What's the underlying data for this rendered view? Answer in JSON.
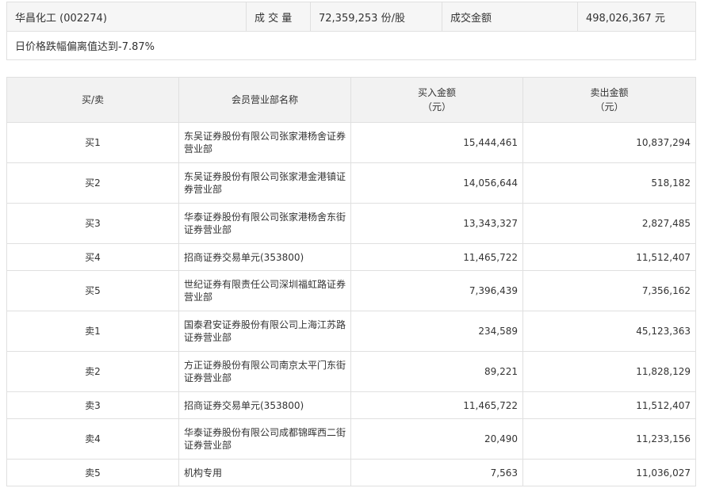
{
  "summary": {
    "stock_name": "华昌化工 (002274)",
    "volume_label": "成 交 量",
    "volume_value": "72,359,253 份/股",
    "amount_label": "成交金额",
    "amount_value": "498,026,367 元",
    "note": "日价格跌幅偏离值达到-7.87%"
  },
  "table": {
    "headers": {
      "side": "买/卖",
      "branch": "会员营业部名称",
      "buy": "买入金额\n（元）",
      "sell": "卖出金额\n（元）"
    },
    "rows": [
      {
        "side": "买1",
        "branch": "东吴证券股份有限公司张家港杨舍证券营业部",
        "buy": "15,444,461",
        "sell": "10,837,294"
      },
      {
        "side": "买2",
        "branch": "东吴证券股份有限公司张家港金港镇证券营业部",
        "buy": "14,056,644",
        "sell": "518,182"
      },
      {
        "side": "买3",
        "branch": "华泰证券股份有限公司张家港杨舍东街证券营业部",
        "buy": "13,343,327",
        "sell": "2,827,485"
      },
      {
        "side": "买4",
        "branch": "招商证券交易单元(353800)",
        "buy": "11,465,722",
        "sell": "11,512,407"
      },
      {
        "side": "买5",
        "branch": "世纪证券有限责任公司深圳福虹路证券营业部",
        "buy": "7,396,439",
        "sell": "7,356,162"
      },
      {
        "side": "卖1",
        "branch": "国泰君安证券股份有限公司上海江苏路证券营业部",
        "buy": "234,589",
        "sell": "45,123,363"
      },
      {
        "side": "卖2",
        "branch": "方正证券股份有限公司南京太平门东街证券营业部",
        "buy": "89,221",
        "sell": "11,828,129"
      },
      {
        "side": "卖3",
        "branch": "招商证券交易单元(353800)",
        "buy": "11,465,722",
        "sell": "11,512,407"
      },
      {
        "side": "卖4",
        "branch": "华泰证券股份有限公司成都锦晖西二街证券营业部",
        "buy": "20,490",
        "sell": "11,233,156"
      },
      {
        "side": "卖5",
        "branch": "机构专用",
        "buy": "7,563",
        "sell": "11,036,027"
      }
    ]
  }
}
